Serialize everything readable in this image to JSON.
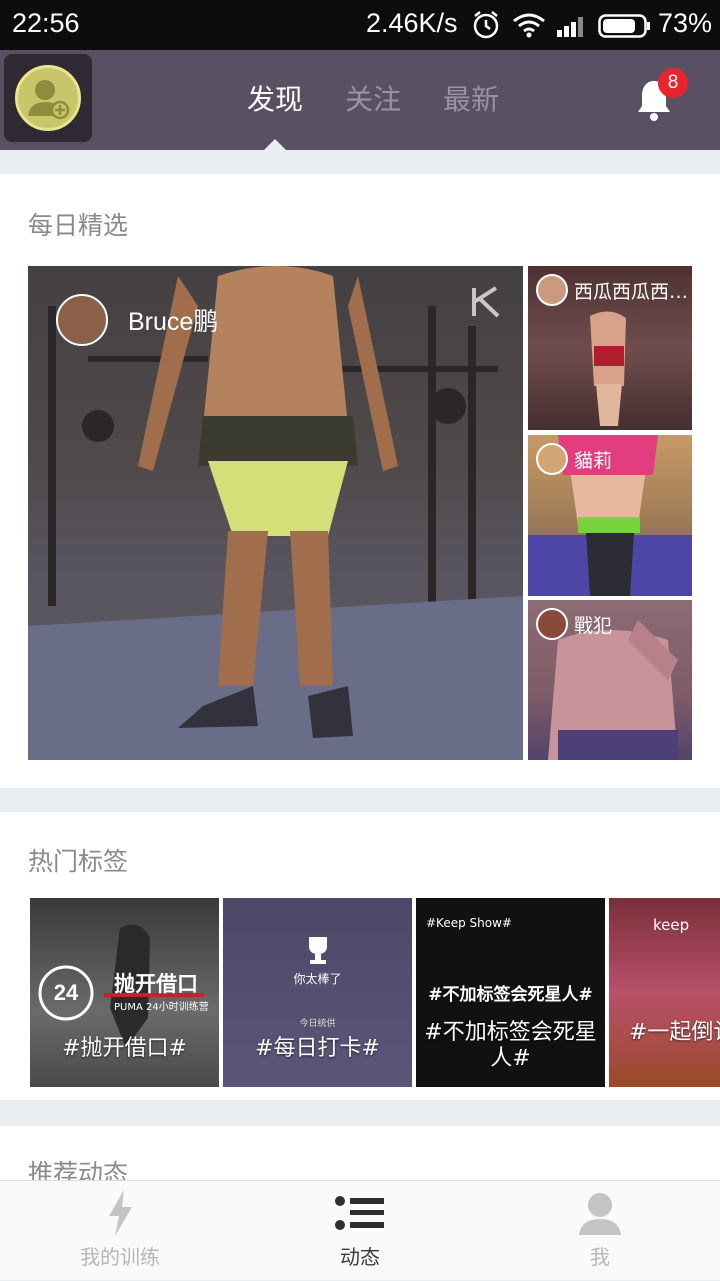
{
  "status": {
    "time": "22:56",
    "net_speed": "2.46K/s",
    "battery": "73%"
  },
  "header": {
    "tabs": [
      {
        "label": "发现",
        "active": true
      },
      {
        "label": "关注",
        "active": false
      },
      {
        "label": "最新",
        "active": false
      }
    ],
    "notification_count": "8"
  },
  "daily": {
    "title": "每日精选",
    "main": {
      "user": "Bruce鹏"
    },
    "side": [
      {
        "user": "西瓜西瓜西…"
      },
      {
        "user": "貓莉"
      },
      {
        "user": "戰犯"
      }
    ]
  },
  "tags": {
    "title": "热门标签",
    "items": [
      {
        "label": "#抛开借口#",
        "poster_heading": "抛开借口",
        "poster_sub": "PUMA 24小时训练营"
      },
      {
        "label": "#每日打卡#",
        "poster_heading": "你太棒了",
        "poster_sub": "今日统供"
      },
      {
        "label": "#不加标签会死星人#",
        "poster_heading": "#不加标签会死星人#",
        "poster_sub": "#Keep Show#"
      },
      {
        "label": "#一起倒计时长#",
        "poster_heading": "keep",
        "poster_sub": ""
      }
    ]
  },
  "feed": {
    "title": "推荐动态"
  },
  "bottom_nav": [
    {
      "label": "我的训练",
      "active": false
    },
    {
      "label": "动态",
      "active": true
    },
    {
      "label": "我",
      "active": false
    }
  ],
  "colors": {
    "header_bg": "#5a5063",
    "badge": "#e8242e",
    "active_tab": "#ffffff",
    "inactive_tab": "#9a92a3"
  }
}
